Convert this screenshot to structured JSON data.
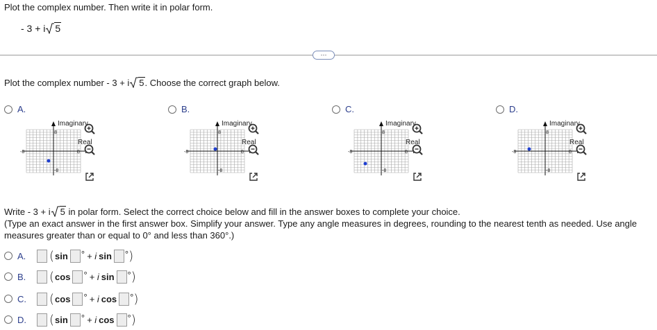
{
  "question": {
    "title": "Plot the complex number. Then write it in polar form.",
    "expr_prefix": "- 3 + i",
    "expr_rad": "5"
  },
  "more_button": "…",
  "part1": {
    "prompt_before": "Plot the complex number  - 3 + i",
    "prompt_rad": "5",
    "prompt_after": ". Choose the correct graph below.",
    "options": [
      {
        "letter": "A.",
        "imag_label": "Imaginary",
        "real_label": "Real"
      },
      {
        "letter": "B.",
        "imag_label": "Imaginary",
        "real_label": "Real"
      },
      {
        "letter": "C.",
        "imag_label": "Imaginary",
        "real_label": "Real"
      },
      {
        "letter": "D.",
        "imag_label": "Imaginary",
        "real_label": "Real"
      }
    ],
    "axis_ticks": {
      "x_neg": "-8",
      "x_pos": "8",
      "y_pos": "8",
      "y_neg": "-8"
    }
  },
  "part2": {
    "prompt_before": "Write  - 3 + i",
    "prompt_rad": "5",
    "prompt_after": " in polar form. Select the correct choice below and fill in the answer boxes to complete your choice.",
    "instructions": "(Type an exact answer in the first answer box. Simplify your answer. Type any angle measures in degrees, rounding to the nearest tenth as needed. Use angle measures greater than or equal to 0° and less than 360°.)",
    "choices": [
      {
        "letter": "A.",
        "f1": "sin",
        "f2": "sin"
      },
      {
        "letter": "B.",
        "f1": "cos",
        "f2": "sin"
      },
      {
        "letter": "C.",
        "f1": "cos",
        "f2": "cos"
      },
      {
        "letter": "D.",
        "f1": "sin",
        "f2": "cos"
      }
    ],
    "plus_i": "+ i",
    "degree": "°",
    "open_paren": "(",
    "close_paren": ")"
  },
  "colors": {
    "point": "#1f3fd0",
    "grid": "#9a9a9a",
    "option_letter": "#2c3e8c"
  }
}
